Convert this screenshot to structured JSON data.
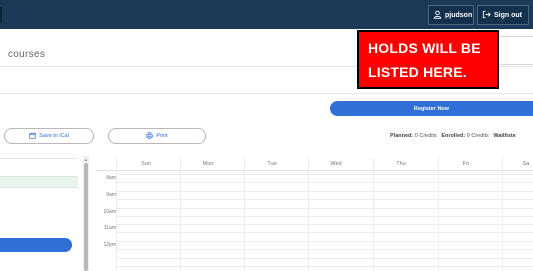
{
  "header": {
    "username": "pjudson",
    "signout_label": "Sign out"
  },
  "page": {
    "title": "courses"
  },
  "overlay": {
    "holds_line1": "HOLDS WILL BE",
    "holds_line2": "LISTED HERE."
  },
  "actions": {
    "register_label": "Register Now",
    "ical_label": "Save to iCal",
    "print_label": "Print"
  },
  "credits": {
    "planned_label": "Planned:",
    "planned_value": "0 Credits",
    "enrolled_label": "Enrolled:",
    "enrolled_value": "9 Credits",
    "waitlisted_label": "Waitliste"
  },
  "calendar": {
    "days": [
      "Sun",
      "Mon",
      "Tue",
      "Wed",
      "Thu",
      "Fri",
      "Sa"
    ],
    "hours": [
      "8am",
      "9am",
      "10am",
      "11am",
      "12pm"
    ]
  },
  "colors": {
    "topbar": "#1c3a57",
    "accent": "#2f6fd6",
    "holds_bg": "#ff0000"
  }
}
